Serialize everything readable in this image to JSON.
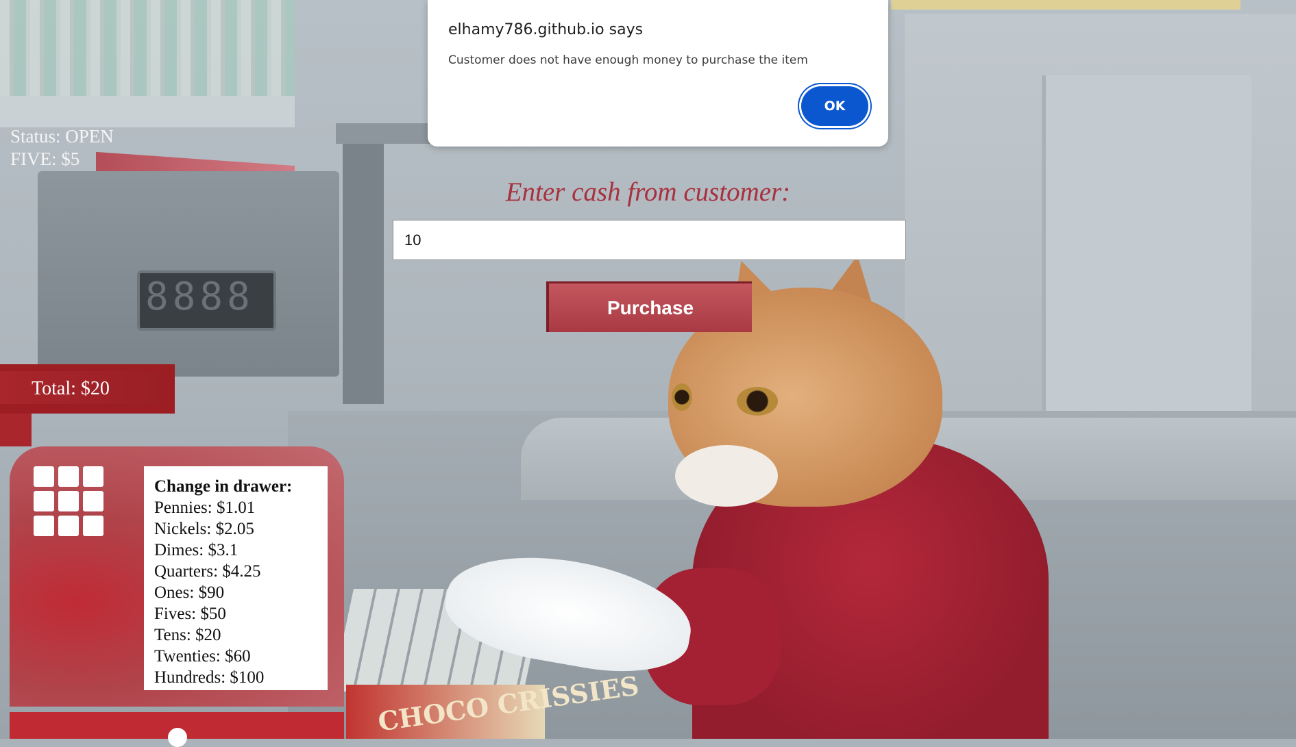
{
  "alert": {
    "title": "elhamy786.github.io says",
    "message": "Customer does not have enough money to purchase the item",
    "ok_label": "OK"
  },
  "status": {
    "status_line": "Status: OPEN",
    "change_line": "FIVE: $5"
  },
  "form": {
    "label": "Enter cash from customer:",
    "cash_value": "10",
    "purchase_label": "Purchase"
  },
  "total": {
    "label": "Total: $20"
  },
  "drawer": {
    "title": "Change in drawer:",
    "items": [
      "Pennies: $1.01",
      "Nickels: $2.05",
      "Dimes: $3.1",
      "Quarters: $4.25",
      "Ones: $90",
      "Fives: $50",
      "Tens: $20",
      "Twenties: $60",
      "Hundreds: $100"
    ]
  },
  "icons": {
    "drawer_icon": "grid-icon"
  },
  "background": {
    "register_display": "8888",
    "box_text": "CHOCO CRISSIES"
  },
  "colors": {
    "accent_red": "#a8313f",
    "ok_blue": "#0b57d0"
  }
}
